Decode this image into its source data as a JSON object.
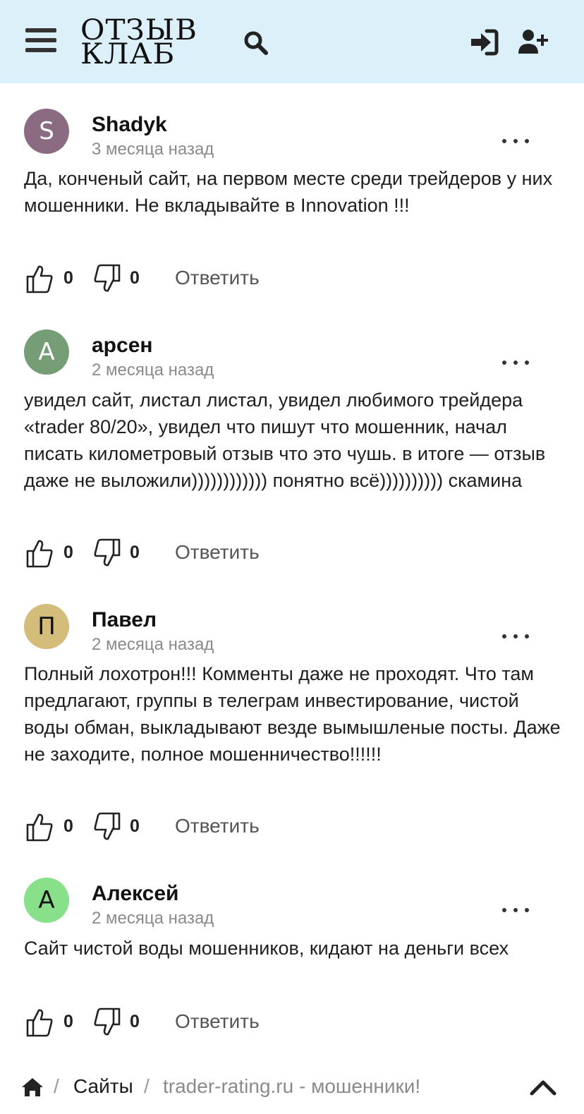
{
  "header": {
    "logo_line1": "ОТЗЫВ",
    "logo_line2": "КЛАБ",
    "icons": [
      "menu-icon",
      "search-icon",
      "login-icon",
      "user-plus-icon"
    ]
  },
  "comments": [
    {
      "initial": "S",
      "avatar_color": "#8a6b82",
      "initial_color": "#ffffff",
      "author": "Shadyk",
      "time": "3 месяца назад",
      "text": "Да, конченый сайт, на первом месте среди трейдеров у них мошенники. Не вкладывайте в Innovation !!!",
      "likes": "0",
      "dislikes": "0",
      "reply_label": "Ответить"
    },
    {
      "initial": "А",
      "avatar_color": "#769e76",
      "initial_color": "#ffffff",
      "author": "арсен",
      "time": "2 месяца назад",
      "text": "увидел сайт, листал листал, увидел любимого трейдера «trader 80/20», увидел что пишут что мошенник, начал писать километровый отзыв что это чушь. в итоге — отзыв даже не выложили)))))))))))) понятно всё)))))))))) скамина",
      "likes": "0",
      "dislikes": "0",
      "reply_label": "Ответить"
    },
    {
      "initial": "П",
      "avatar_color": "#d4bd7a",
      "initial_color": "#111111",
      "author": "Павел",
      "time": "2 месяца назад",
      "text": "Полный лохотрон!!! Комменты даже не проходят. Что там предлагают, группы в телеграм инвестирование, чистой воды обман, выкладывают везде вымышленые посты. Даже не заходите, полное мошенничество!!!!!!",
      "likes": "0",
      "dislikes": "0",
      "reply_label": "Ответить"
    },
    {
      "initial": "А",
      "avatar_color": "#88e08a",
      "initial_color": "#111111",
      "author": "Алексей",
      "time": "2 месяца назад",
      "text": "Сайт чистой воды мошенников, кидают на деньги всех",
      "likes": "0",
      "dislikes": "0",
      "reply_label": "Ответить"
    }
  ],
  "breadcrumb": {
    "separator": "/",
    "link": "Сайты",
    "current": "trader-rating.ru - мошенники!"
  }
}
